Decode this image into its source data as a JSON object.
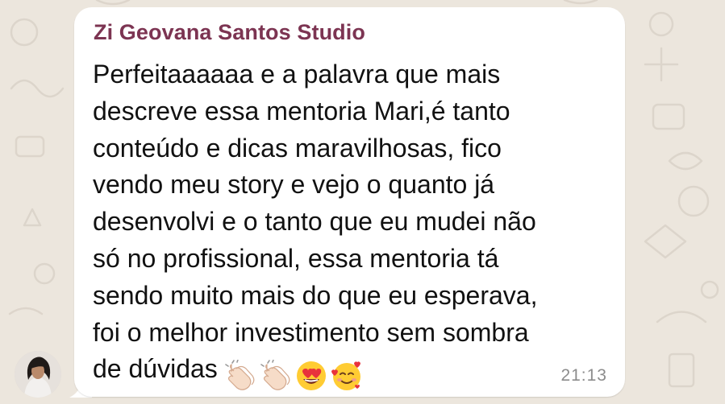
{
  "chat": {
    "sender_name": "Zi Geovana Santos Studio",
    "message_lines": [
      "Perfeitaaaaaa e a palavra que mais",
      "descreve essa mentoria Mari,é tanto",
      "conteúdo e dicas maravilhosas, fico",
      "vendo meu story e vejo o quanto já",
      "desenvolvi e o tanto que eu mudei não",
      "só no profissional, essa mentoria tá",
      "sendo muito mais do que eu esperava,",
      "foi o melhor investimento sem sombra",
      "de dúvidas"
    ],
    "emojis": [
      "clapping-hands",
      "clapping-hands",
      "heart-eyes-face",
      "smiling-face-with-hearts"
    ],
    "timestamp": "21:13"
  },
  "colors": {
    "background": "#ece6dd",
    "bubble": "#ffffff",
    "sender_name": "#7c3452",
    "message_text": "#111111",
    "timestamp": "#8c8c8c"
  }
}
